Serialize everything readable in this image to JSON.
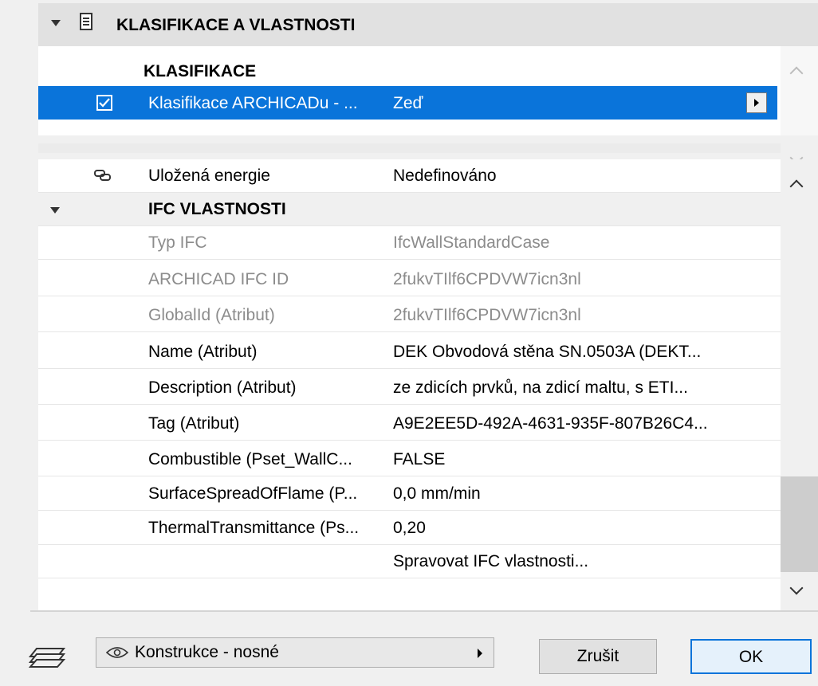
{
  "section": {
    "title": "KLASIFIKACE A VLASTNOSTI",
    "icon": "document-icon"
  },
  "classification": {
    "header": "KLASIFIKACE",
    "selected_row": {
      "checked": true,
      "name": "Klasifikace ARCHICADu - ...",
      "value": "Zeď"
    }
  },
  "properties": {
    "energy_row": {
      "icon": "link-icon",
      "key": "Uložená energie",
      "value": "Nedefinováno"
    },
    "ifc_group": "IFC VLASTNOSTI",
    "rows": [
      {
        "key": "Typ IFC",
        "value": "IfcWallStandardCase",
        "dim": true
      },
      {
        "key": "ARCHICAD IFC ID",
        "value": "2fukvTIlf6CPDVW7icn3nl",
        "dim": true
      },
      {
        "key": "GlobalId (Atribut)",
        "value": "2fukvTIlf6CPDVW7icn3nl",
        "dim": true
      },
      {
        "key": "Name (Atribut)",
        "value": "DEK Obvodová stěna SN.0503A (DEKT...",
        "dim": false
      },
      {
        "key": "Description (Atribut)",
        "value": "ze zdicích prvků, na zdicí maltu, s ETI...",
        "dim": false
      },
      {
        "key": "Tag (Atribut)",
        "value": "A9E2EE5D-492A-4631-935F-807B26C4...",
        "dim": false
      },
      {
        "key": "Combustible (Pset_WallC...",
        "value": "FALSE",
        "dim": false
      },
      {
        "key": "SurfaceSpreadOfFlame (P...",
        "value": "0,0 mm/min",
        "dim": false
      },
      {
        "key": "ThermalTransmittance (Ps...",
        "value": "0,20",
        "dim": false
      },
      {
        "key": "",
        "value": "Spravovat IFC vlastnosti...",
        "dim": false
      }
    ]
  },
  "footer": {
    "layer_label": "Konstrukce - nosné",
    "cancel": "Zrušit",
    "ok": "OK"
  }
}
